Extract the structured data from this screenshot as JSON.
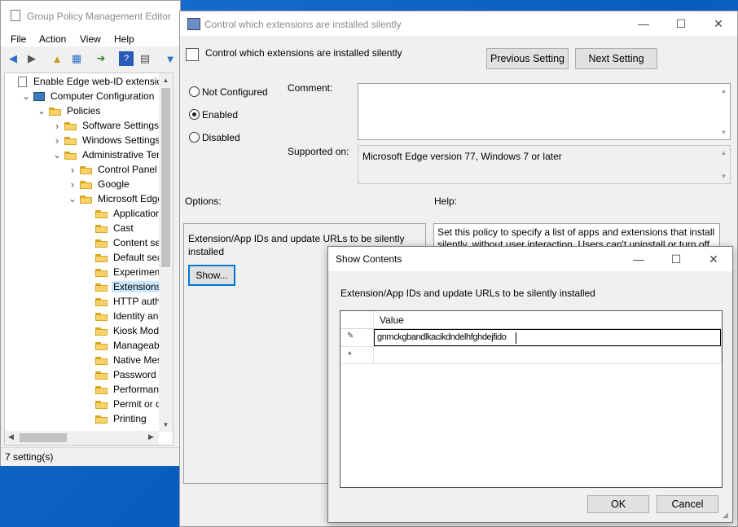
{
  "gpme": {
    "title": "Group Policy Management Editor",
    "menu": [
      "File",
      "Action",
      "View",
      "Help"
    ],
    "tree": [
      {
        "label": "Enable Edge web-ID extension [",
        "icon": "gpo-icon",
        "indent": 0,
        "exp": ""
      },
      {
        "label": "Computer Configuration",
        "icon": "computer-icon",
        "indent": 1,
        "exp": "v"
      },
      {
        "label": "Policies",
        "icon": "folder-icon",
        "indent": 2,
        "exp": "v"
      },
      {
        "label": "Software Settings",
        "icon": "folder-icon",
        "indent": 3,
        "exp": ">"
      },
      {
        "label": "Windows Settings",
        "icon": "folder-icon",
        "indent": 3,
        "exp": ">"
      },
      {
        "label": "Administrative Temp",
        "icon": "folder-icon",
        "indent": 3,
        "exp": "v"
      },
      {
        "label": "Control Panel",
        "icon": "folder-icon",
        "indent": 4,
        "exp": ">"
      },
      {
        "label": "Google",
        "icon": "folder-icon",
        "indent": 4,
        "exp": ">"
      },
      {
        "label": "Microsoft Edge",
        "icon": "folder-icon",
        "indent": 4,
        "exp": "v"
      },
      {
        "label": "Application G",
        "icon": "folder-icon",
        "indent": 5,
        "exp": ""
      },
      {
        "label": "Cast",
        "icon": "folder-icon",
        "indent": 5,
        "exp": ""
      },
      {
        "label": "Content setti",
        "icon": "folder-icon",
        "indent": 5,
        "exp": ""
      },
      {
        "label": "Default searc",
        "icon": "folder-icon",
        "indent": 5,
        "exp": ""
      },
      {
        "label": "Experimentat",
        "icon": "folder-icon",
        "indent": 5,
        "exp": ""
      },
      {
        "label": "Extensions",
        "icon": "folder-icon",
        "indent": 5,
        "exp": "",
        "selected": true
      },
      {
        "label": "HTTP authen",
        "icon": "folder-icon",
        "indent": 5,
        "exp": ""
      },
      {
        "label": "Identity and s",
        "icon": "folder-icon",
        "indent": 5,
        "exp": ""
      },
      {
        "label": "Kiosk Mode s",
        "icon": "folder-icon",
        "indent": 5,
        "exp": ""
      },
      {
        "label": "Manageabili",
        "icon": "folder-icon",
        "indent": 5,
        "exp": ""
      },
      {
        "label": "Native Messa",
        "icon": "folder-icon",
        "indent": 5,
        "exp": ""
      },
      {
        "label": "Password ma",
        "icon": "folder-icon",
        "indent": 5,
        "exp": ""
      },
      {
        "label": "Performance",
        "icon": "folder-icon",
        "indent": 5,
        "exp": ""
      },
      {
        "label": "Permit or der",
        "icon": "folder-icon",
        "indent": 5,
        "exp": ""
      },
      {
        "label": "Printing",
        "icon": "folder-icon",
        "indent": 5,
        "exp": ""
      }
    ],
    "status": "7 setting(s)"
  },
  "policy": {
    "window_title": "Control which extensions are installed silently",
    "header_title": "Control which extensions are installed silently",
    "prev_button": "Previous Setting",
    "next_button": "Next Setting",
    "radio_not_configured": "Not Configured",
    "radio_enabled": "Enabled",
    "radio_disabled": "Disabled",
    "comment_label": "Comment:",
    "supported_label": "Supported on:",
    "supported_value": "Microsoft Edge version 77, Windows 7 or later",
    "options_label": "Options:",
    "help_label": "Help:",
    "option_text": "Extension/App IDs and update URLs to be silently installed",
    "show_button": "Show...",
    "help_text": "Set this policy to specify a list of apps and extensions that install silently, without user interaction. Users can't uninstall or turn off"
  },
  "show_contents": {
    "title": "Show Contents",
    "description": "Extension/App IDs and update URLs to be silently installed",
    "column_header": "Value",
    "rows": [
      {
        "marker": "✎",
        "value": "gnmckgbandlkacikdndelhfghdejfido"
      },
      {
        "marker": "*",
        "value": ""
      }
    ],
    "ok_button": "OK",
    "cancel_button": "Cancel"
  }
}
